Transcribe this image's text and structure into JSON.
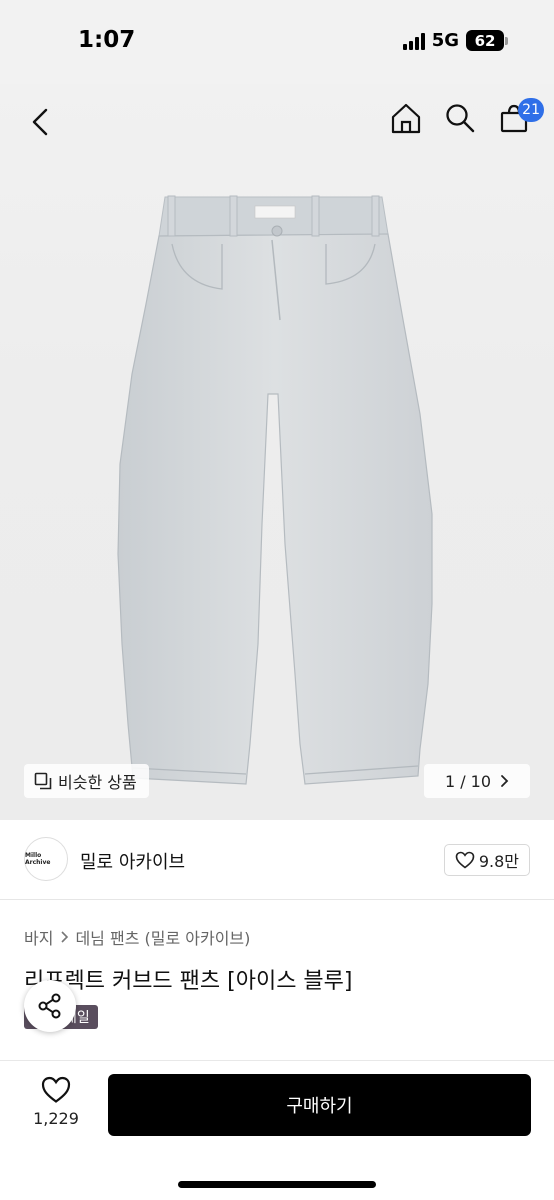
{
  "status_bar": {
    "time": "1:07",
    "network": "5G",
    "battery": "62"
  },
  "nav": {
    "cart_count": "21"
  },
  "gallery": {
    "similar_label": "비슷한 상품",
    "pager": "1 / 10",
    "tag_text": "Millo Archive"
  },
  "seller": {
    "avatar_text": "Millo Archive",
    "name": "밀로 아카이브",
    "likes": "9.8만"
  },
  "breadcrumb": {
    "category": "바지",
    "sub": "데님 팬츠 (밀로 아카이브)"
  },
  "product": {
    "title": "리프렉트 커브드 팬츠 [아이스 블루]",
    "sale_badge": "세일"
  },
  "bottom": {
    "wish_count": "1,229",
    "buy_label": "구매하기"
  },
  "colors": {
    "accent": "#2f6fe8",
    "buy": "#000000",
    "badge": "#5a4e5e",
    "denim": "#d6dadd"
  }
}
